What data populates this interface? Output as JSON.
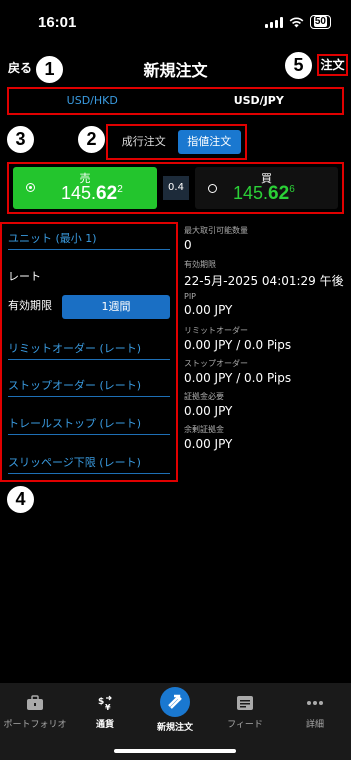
{
  "status": {
    "time": "16:01",
    "battery": "50"
  },
  "nav": {
    "back": "戻る",
    "title": "新規注文",
    "order": "注文"
  },
  "callouts": [
    "1",
    "2",
    "3",
    "4",
    "5"
  ],
  "pairs": [
    {
      "label": "USD/HKD"
    },
    {
      "label": "USD/JPY"
    }
  ],
  "order_types": [
    {
      "label": "成行注文"
    },
    {
      "label": "指値注文"
    }
  ],
  "sell": {
    "label": "売",
    "price_prefix": "145.",
    "price_big": "62",
    "price_sup": "2"
  },
  "spread": "0.4",
  "buy": {
    "label": "買",
    "price_prefix": "145.",
    "price_big": "62",
    "price_sup": "6"
  },
  "form": {
    "unit": "ユニット (最小 1)",
    "rate": "レート",
    "expiry_label": "有効期限",
    "expiry_value": "1週間",
    "limit": "リミットオーダー (レート)",
    "stop": "ストップオーダー (レート)",
    "trailing": "トレールストップ (レート)",
    "slippage": "スリッページ下限 (レート)"
  },
  "info": [
    {
      "label": "最大取引可能数量",
      "value": "0"
    },
    {
      "label": "有効期限",
      "value": "22-5月-2025 04:01:29 午後"
    },
    {
      "label": "PIP",
      "value": "0.00 JPY"
    },
    {
      "label": "リミットオーダー",
      "value": "0.00 JPY / 0.0 Pips"
    },
    {
      "label": "ストップオーダー",
      "value": "0.00 JPY / 0.0 Pips"
    },
    {
      "label": "証拠金必要",
      "value": "0.00 JPY"
    },
    {
      "label": "余剰証拠金",
      "value": "0.00 JPY"
    }
  ],
  "tabs": [
    {
      "label": "ポートフォリオ",
      "icon": "briefcase-icon"
    },
    {
      "label": "通貨",
      "icon": "currency-exchange-icon"
    },
    {
      "label": "新規注文",
      "icon": "new-order-icon"
    },
    {
      "label": "フィード",
      "icon": "feed-icon"
    },
    {
      "label": "詳細",
      "icon": "more-icon"
    }
  ],
  "colors": {
    "accent": "#1a78d0",
    "sell": "#23c52d",
    "buy_text": "#2bd037",
    "highlight": "#e00000"
  }
}
